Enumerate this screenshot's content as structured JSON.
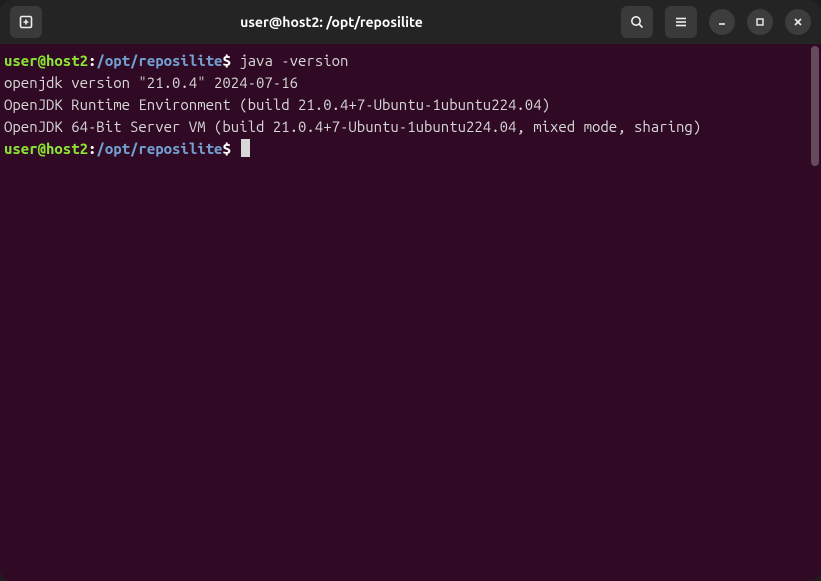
{
  "titlebar": {
    "title": "user@host2: /opt/reposilite"
  },
  "prompt": {
    "user_host": "user@host2",
    "colon": ":",
    "path": "/opt/reposilite",
    "dollar": "$"
  },
  "lines": {
    "command1": "java -version",
    "out1": "openjdk version \"21.0.4\" 2024-07-16",
    "out2": "OpenJDK Runtime Environment (build 21.0.4+7-Ubuntu-1ubuntu224.04)",
    "out3": "OpenJDK 64-Bit Server VM (build 21.0.4+7-Ubuntu-1ubuntu224.04, mixed mode, sharing)"
  }
}
